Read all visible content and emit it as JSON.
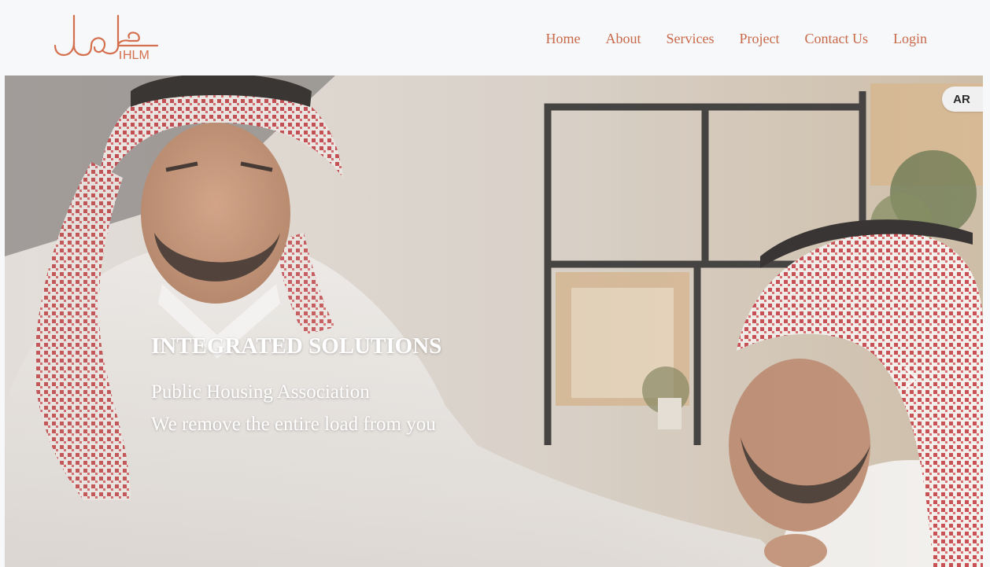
{
  "brand": {
    "logo_latin": "HLM",
    "logo_arabic": "حلول",
    "accent_color": "#c8694a"
  },
  "nav": {
    "items": [
      {
        "label": "Home"
      },
      {
        "label": "About"
      },
      {
        "label": "Services"
      },
      {
        "label": "Project"
      },
      {
        "label": "Contact Us"
      },
      {
        "label": "Login"
      }
    ],
    "color": "#c8694a"
  },
  "hero": {
    "title": "INTEGRATED SOLUTIONS",
    "line1": "Public Housing Association",
    "line2": "We remove the entire load from you",
    "text_color": "#ffffff",
    "next_icon": "chevron-right-icon",
    "language_button": "AR"
  }
}
